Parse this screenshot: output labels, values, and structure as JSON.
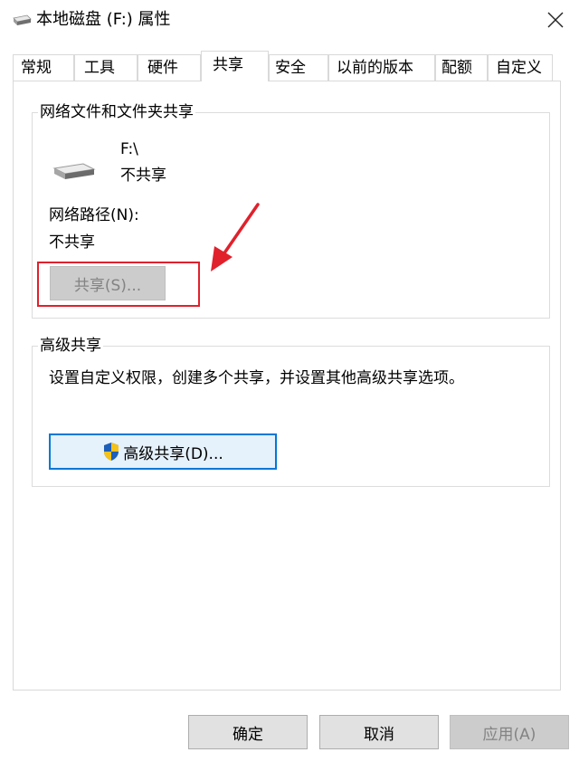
{
  "window": {
    "title": "本地磁盘 (F:) 属性",
    "icon": "drive-icon",
    "close_icon": "close-icon"
  },
  "tabs": [
    {
      "label": "常规",
      "active": false
    },
    {
      "label": "工具",
      "active": false
    },
    {
      "label": "硬件",
      "active": false
    },
    {
      "label": "共享",
      "active": true
    },
    {
      "label": "安全",
      "active": false
    },
    {
      "label": "以前的版本",
      "active": false
    },
    {
      "label": "配额",
      "active": false
    },
    {
      "label": "自定义",
      "active": false
    }
  ],
  "network_sharing": {
    "legend": "网络文件和文件夹共享",
    "drive_icon": "drive-icon",
    "drive_name": "F:\\",
    "drive_status": "不共享",
    "network_path_label": "网络路径(N):",
    "network_path_value": "不共享",
    "share_button": "共享(S)...",
    "share_button_enabled": false
  },
  "advanced_sharing": {
    "legend": "高级共享",
    "description": "设置自定义权限，创建多个共享，并设置其他高级共享选项。",
    "button_icon": "uac-shield-icon",
    "button_label": "高级共享(D)..."
  },
  "annotation": {
    "arrow_color": "#e0212c",
    "box_color": "#e0212c"
  },
  "dialog_buttons": {
    "ok": "确定",
    "cancel": "取消",
    "apply": "应用(A)",
    "apply_enabled": false
  },
  "colors": {
    "focus_border": "#0078d7",
    "disabled_bg": "#cccccc",
    "disabled_text": "#838383"
  }
}
